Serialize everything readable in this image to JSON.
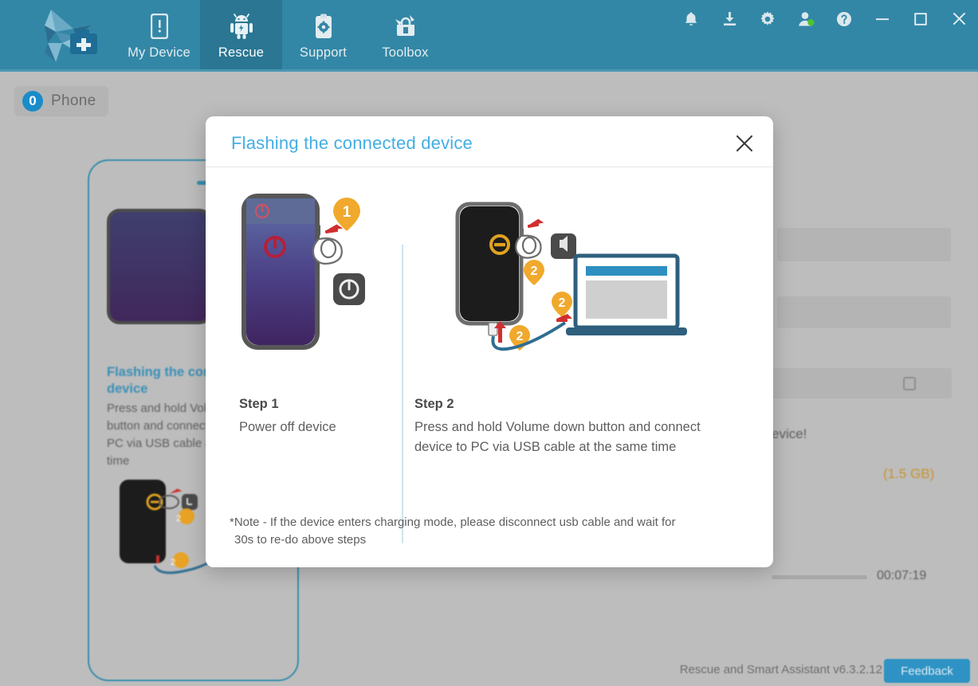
{
  "header": {
    "logo_name": "rescue-assistant-logo",
    "nav": [
      {
        "id": "my-device",
        "label": "My Device",
        "icon": "phone-alert-icon",
        "active": false
      },
      {
        "id": "rescue",
        "label": "Rescue",
        "icon": "android-rescue-icon",
        "active": true
      },
      {
        "id": "support",
        "label": "Support",
        "icon": "clipboard-gear-icon",
        "active": false
      },
      {
        "id": "toolbox",
        "label": "Toolbox",
        "icon": "toolbox-icon",
        "active": false
      }
    ],
    "window_controls": [
      {
        "id": "notifications",
        "icon": "bell-icon"
      },
      {
        "id": "downloads",
        "icon": "download-icon"
      },
      {
        "id": "settings",
        "icon": "gear-icon"
      },
      {
        "id": "account",
        "icon": "user-online-icon"
      },
      {
        "id": "help",
        "icon": "help-circle-icon"
      },
      {
        "id": "minimize",
        "icon": "minimize-icon"
      },
      {
        "id": "maximize",
        "icon": "maximize-icon"
      },
      {
        "id": "close",
        "icon": "close-icon"
      }
    ]
  },
  "stage": {
    "tab_chip": {
      "label": "Phone",
      "icon": "phone-circle-icon"
    },
    "card": {
      "heading": "Flashing the connected device",
      "body": "Press and hold Volume down button and connect device to PC via USB cable at the same time"
    },
    "right_panel": {
      "device_text": "evice!",
      "size_label": "(1.5 GB)",
      "size_color": "#c8932f",
      "timer": "00:07:19"
    }
  },
  "footer": {
    "version": "Rescue and Smart Assistant v6.3.2.12",
    "feedback_label": "Feedback"
  },
  "modal": {
    "title": "Flashing the connected device",
    "close_icon": "close-icon",
    "steps": [
      {
        "id": "step-1",
        "title": "Step 1",
        "desc": "Power off device",
        "illustration": "phone-power-off-illustration",
        "badges": [
          "1"
        ]
      },
      {
        "id": "step-2",
        "title": "Step 2",
        "desc": "Press and hold Volume down button and connect device to PC via USB cable at the same time",
        "illustration": "phone-volume-down-usb-laptop-illustration",
        "badges": [
          "2",
          "2",
          "2"
        ]
      }
    ],
    "note_marker": "*",
    "note_line1": "Note - If the device enters charging mode, please disconnect usb cable and wait for",
    "note_line2": "30s to re-do above steps"
  },
  "colors": {
    "header_bg": "#3387a6",
    "header_active": "#2a7693",
    "stage_bg": "#bdbdbd",
    "modal_title": "#44aee4",
    "accent_blue": "#2e93c4",
    "badge_orange": "#f0a92c",
    "arrow_red": "#d93a3a"
  }
}
